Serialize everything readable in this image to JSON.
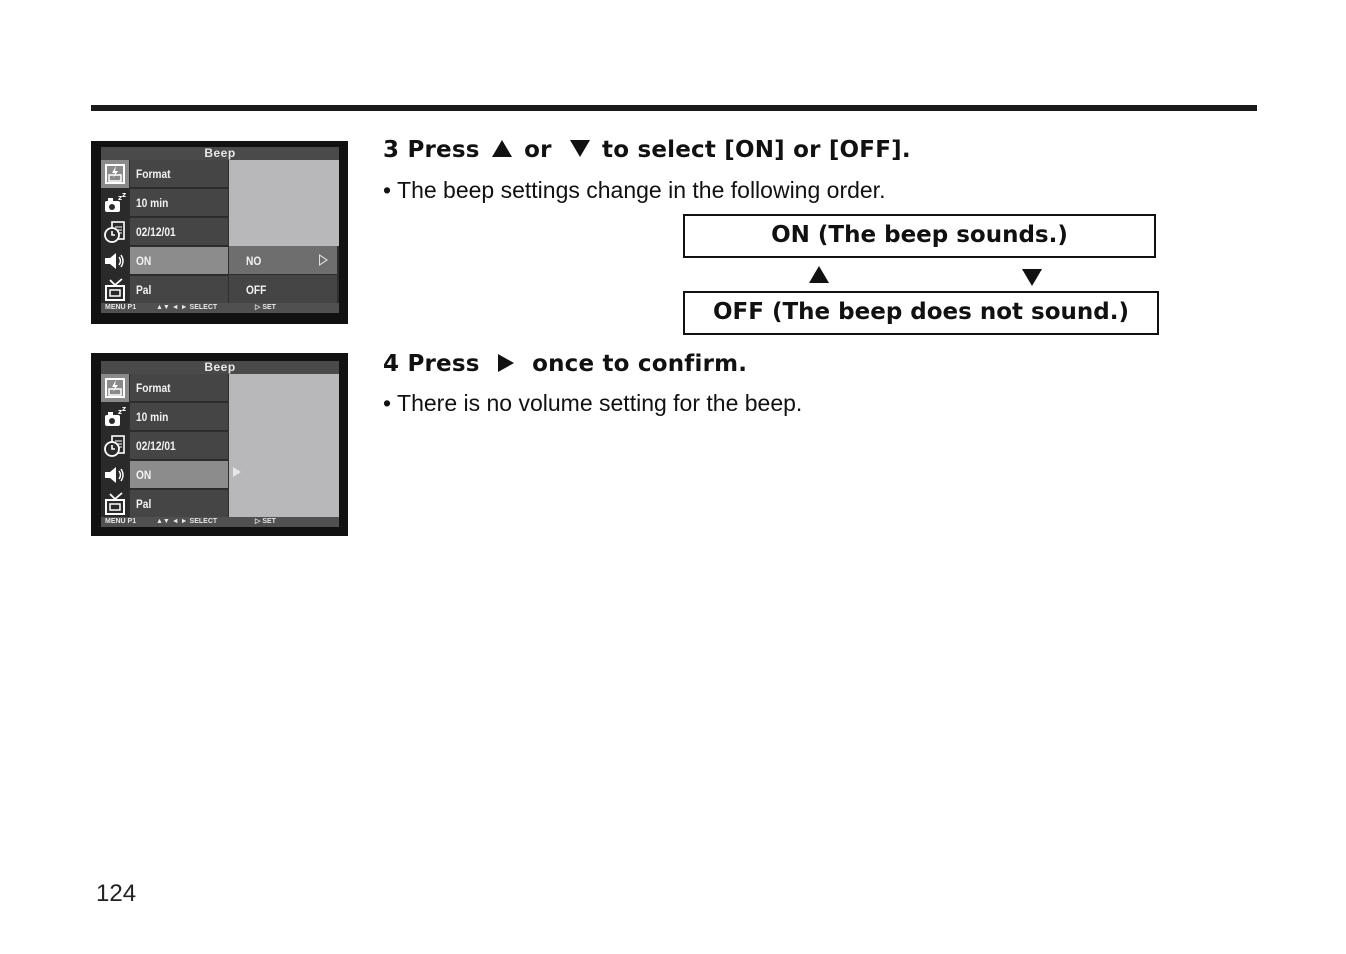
{
  "page": {
    "number": "124"
  },
  "screens": [
    {
      "title": "Beep",
      "menu_items": [
        {
          "icon": "format-icon",
          "label": "Format"
        },
        {
          "icon": "camera-sleep-icon",
          "label": "10 min"
        },
        {
          "icon": "clock-date-icon",
          "label": "02/12/01"
        },
        {
          "icon": "speaker-icon",
          "label": "ON",
          "selected": true
        },
        {
          "icon": "tv-icon",
          "label": "Pal"
        }
      ],
      "options": [
        {
          "label": "NO",
          "selected": true
        },
        {
          "label": "OFF"
        }
      ],
      "footer": {
        "menu": "MENU P1",
        "select": "▲▼  ◄ ► SELECT",
        "set": "▷  SET"
      }
    },
    {
      "title": "Beep",
      "menu_items": [
        {
          "icon": "format-icon",
          "label": "Format"
        },
        {
          "icon": "camera-sleep-icon",
          "label": "10 min"
        },
        {
          "icon": "clock-date-icon",
          "label": "02/12/01"
        },
        {
          "icon": "speaker-icon",
          "label": "ON",
          "selected": true
        },
        {
          "icon": "tv-icon",
          "label": "Pal"
        }
      ],
      "footer": {
        "menu": "MENU P1",
        "select": "▲▼  ◄ ► SELECT",
        "set": "▷  SET"
      }
    }
  ],
  "steps": [
    {
      "number": "3",
      "parts": [
        "Press",
        "or",
        "to select [ON] or [OFF]."
      ],
      "buttons": [
        "up-arrow",
        "down-arrow"
      ],
      "bullet": "• The beep settings change in the following order."
    },
    {
      "number": "4",
      "parts": [
        "Press",
        "once to confirm."
      ],
      "buttons": [
        "right-arrow"
      ],
      "bullet": "• There is no volume setting for the beep."
    }
  ],
  "flow": {
    "on_label": "ON (The beep sounds.)",
    "off_label": "OFF (The beep does not sound.)"
  }
}
